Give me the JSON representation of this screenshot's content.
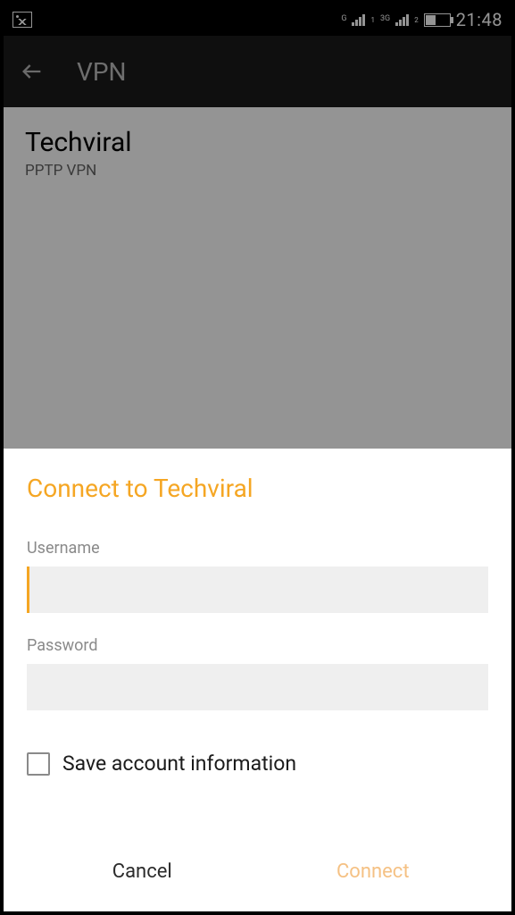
{
  "status": {
    "net1_label": "G",
    "net1_sub": "1",
    "net2_label": "3G",
    "net2_sub": "2",
    "time": "21:48"
  },
  "appbar": {
    "title": "VPN"
  },
  "vpn_list": {
    "items": [
      {
        "name": "Techviral",
        "type": "PPTP VPN"
      }
    ]
  },
  "dialog": {
    "title": "Connect to Techviral",
    "username_label": "Username",
    "username_value": "",
    "password_label": "Password",
    "password_value": "",
    "save_label": "Save account information",
    "save_checked": false,
    "cancel_label": "Cancel",
    "connect_label": "Connect"
  }
}
